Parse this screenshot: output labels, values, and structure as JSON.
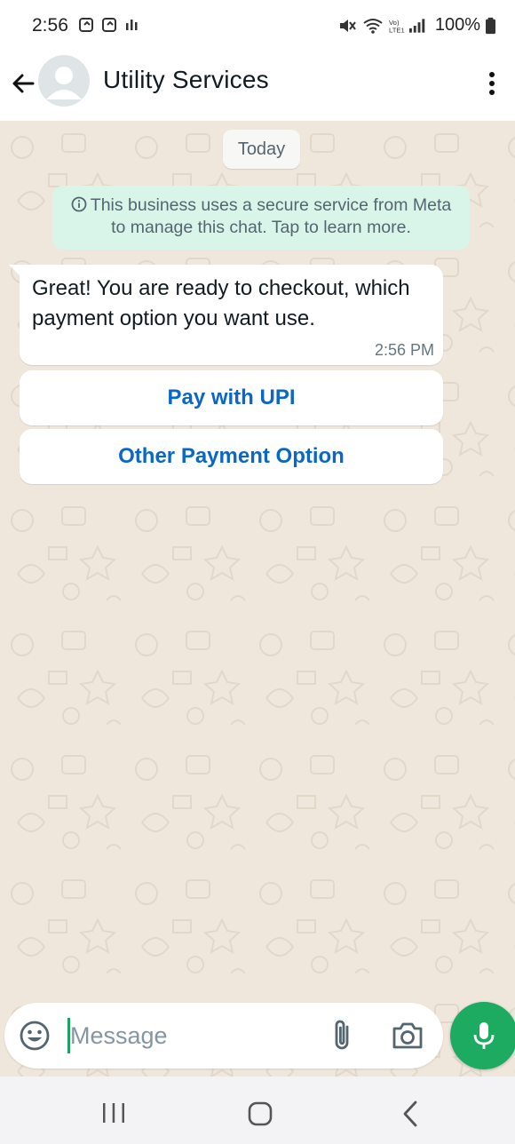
{
  "status_bar": {
    "time": "2:56",
    "battery": "100%"
  },
  "header": {
    "contact_name": "Utility Services"
  },
  "chat": {
    "date_chip": "Today",
    "encryption_notice": "This business uses a secure service from Meta to manage this chat. Tap to learn more.",
    "message": {
      "text": "Great! You are ready to checkout, which payment option you want use.",
      "time": "2:56 PM"
    },
    "reply_buttons": [
      {
        "label": "Pay with UPI"
      },
      {
        "label": "Other Payment Option"
      }
    ]
  },
  "composer": {
    "placeholder": "Message"
  },
  "icons": {
    "back": "arrow-left-icon",
    "menu": "kebab-menu-icon",
    "emoji": "emoji-icon",
    "attach": "paperclip-icon",
    "camera": "camera-icon",
    "mic": "microphone-icon",
    "info": "info-icon"
  },
  "colors": {
    "chat_background": "#efe7dc",
    "notice_background": "#d9f5ea",
    "button_text": "#0b67c7",
    "mic_button": "#1daa61"
  }
}
